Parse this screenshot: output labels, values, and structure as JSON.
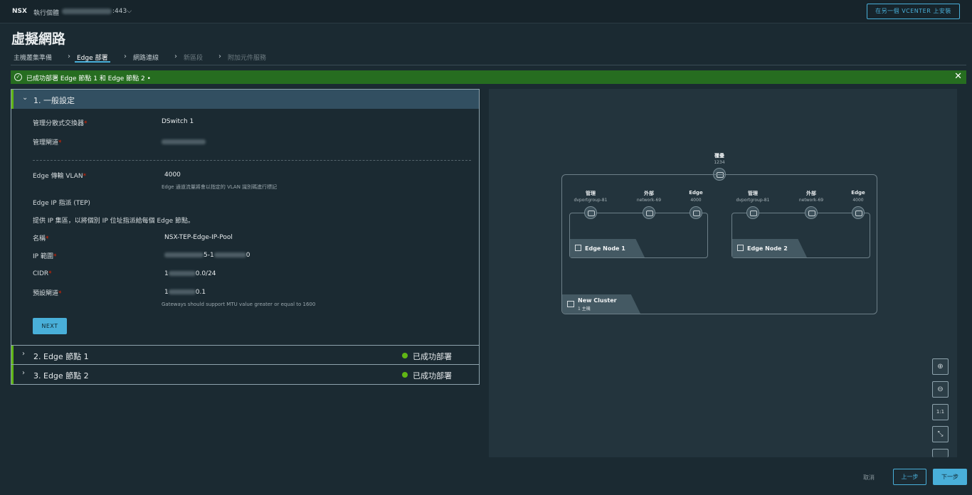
{
  "topbar": {
    "brand": "NSX",
    "host_label": "執行個體",
    "host_port": ":443⌵",
    "vcenter_button": "在另一個 VCENTER 上安裝"
  },
  "page": {
    "title": "虛擬網路"
  },
  "tabs": [
    {
      "label": "主機叢集準備",
      "state": "done"
    },
    {
      "label": "Edge 部署",
      "state": "active"
    },
    {
      "label": "網路連線",
      "state": "normal"
    },
    {
      "label": "新區段",
      "state": "disabled"
    },
    {
      "label": "附加元件服務",
      "state": "disabled"
    }
  ],
  "alert": {
    "text": "已成功部署 Edge 節點 1 和 Edge 節點 2 •",
    "close": "✕"
  },
  "accordion": {
    "general": {
      "title": "1. 一般設定",
      "fields": {
        "dvs_label": "管理分散式交換器",
        "dvs_value": "DSwitch 1",
        "gw_label": "管理閘道",
        "vlan_label": "Edge 傳輸 VLAN",
        "vlan_value": "4000",
        "vlan_help": "Edge 通道流量將會以指定的 VLAN 識別碼進行標記",
        "tep_heading": "Edge IP 指派 (TEP)",
        "tep_desc": "提供 IP 集區，以將個別 IP 位址指派給每個 Edge 節點。",
        "name_label": "名稱",
        "name_value": "NSX-TEP-Edge-IP-Pool",
        "range_label": "IP 範圍",
        "range_mid": "5-1",
        "range_end": "0",
        "cidr_label": "CIDR",
        "cidr_prefix": "1",
        "cidr_suffix": "0.0/24",
        "gateway_label": "預設閘道",
        "gateway_prefix": "1",
        "gateway_suffix": "0.1",
        "gateway_help": "Gateways should support MTU value greater or equal to 1600"
      },
      "next_button": "NEXT"
    },
    "node1": {
      "title": "2. Edge 節點 1",
      "status": "已成功部署"
    },
    "node2": {
      "title": "3. Edge 節點 2",
      "status": "已成功部署"
    }
  },
  "topology": {
    "overlay": {
      "label": "覆疊",
      "sub": "1234"
    },
    "nodes": [
      {
        "name": "Edge Node 1",
        "ports": [
          {
            "label": "管理",
            "sub": "dvportgroup-81"
          },
          {
            "label": "外部",
            "sub": "network-69"
          },
          {
            "label": "Edge",
            "sub": "4000"
          }
        ]
      },
      {
        "name": "Edge Node 2",
        "ports": [
          {
            "label": "管理",
            "sub": "dvportgroup-81"
          },
          {
            "label": "外部",
            "sub": "network-69"
          },
          {
            "label": "Edge",
            "sub": "4000"
          }
        ]
      }
    ],
    "cluster": {
      "name": "New Cluster",
      "sub": "1 主機"
    },
    "zoom": {
      "in": "⊕",
      "out": "⊖",
      "reset": "1:1",
      "fit": "⤡"
    }
  },
  "footer": {
    "cancel": "取消",
    "prev": "上一步",
    "next": "下一步"
  },
  "colors": {
    "accent": "#49afd9",
    "success": "#60b515",
    "alert_bg": "#266d20",
    "required": "#e12200"
  }
}
